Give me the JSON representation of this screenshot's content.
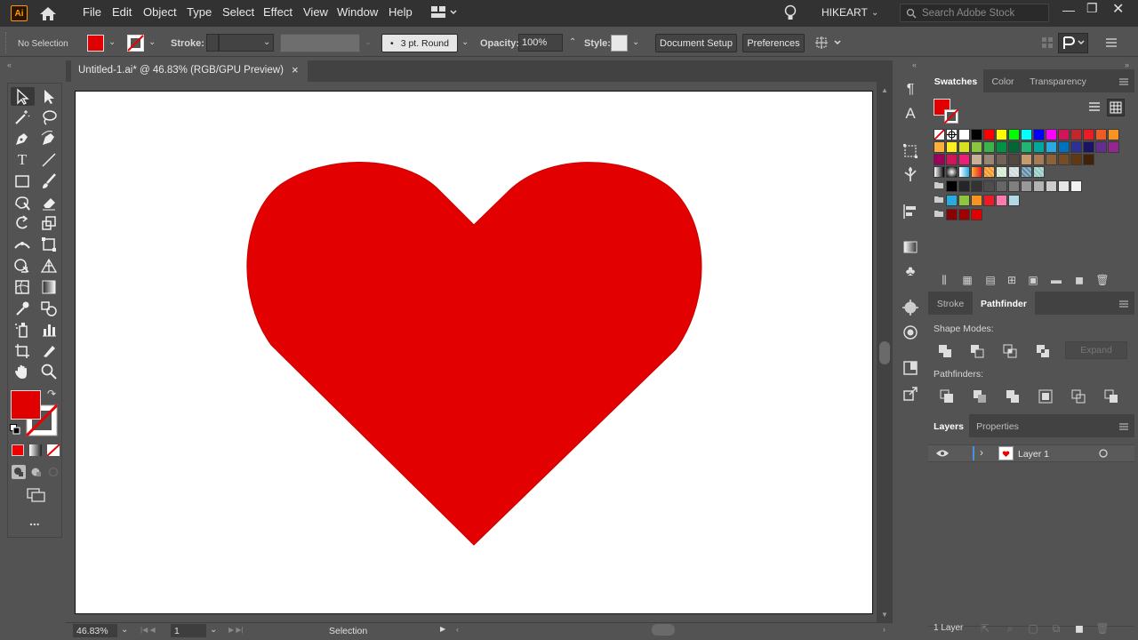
{
  "app": {
    "logo": "Ai",
    "workspace": "HIKEART"
  },
  "menu": [
    "File",
    "Edit",
    "Object",
    "Type",
    "Select",
    "Effect",
    "View",
    "Window",
    "Help"
  ],
  "search": {
    "placeholder": "Search Adobe Stock"
  },
  "control_bar": {
    "selection_status": "No Selection",
    "stroke_label": "Stroke:",
    "brush_label": "3 pt. Round",
    "opacity_label": "Opacity:",
    "opacity_value": "100%",
    "style_label": "Style:",
    "document_setup": "Document Setup",
    "preferences": "Preferences"
  },
  "document_tab": {
    "title": "Untitled-1.ai* @ 46.83% (RGB/GPU Preview)",
    "close": "×"
  },
  "status_bar": {
    "zoom": "46.83%",
    "artboard": "1",
    "tool": "Selection"
  },
  "colors": {
    "fill": "#e00000",
    "heart": "#e30000",
    "accent": "#4a90e2"
  },
  "swatches_panel": {
    "tabs": [
      "Swatches",
      "Color",
      "Transparency"
    ]
  },
  "stroke_pathfinder_panel": {
    "tabs": [
      "Stroke",
      "Pathfinder"
    ],
    "shape_modes_label": "Shape Modes:",
    "expand_label": "Expand",
    "pathfinders_label": "Pathfinders:"
  },
  "layers_panel": {
    "tabs": [
      "Layers",
      "Properties"
    ],
    "layer_name": "Layer 1",
    "count_label": "1 Layer"
  },
  "more_tools": "..."
}
